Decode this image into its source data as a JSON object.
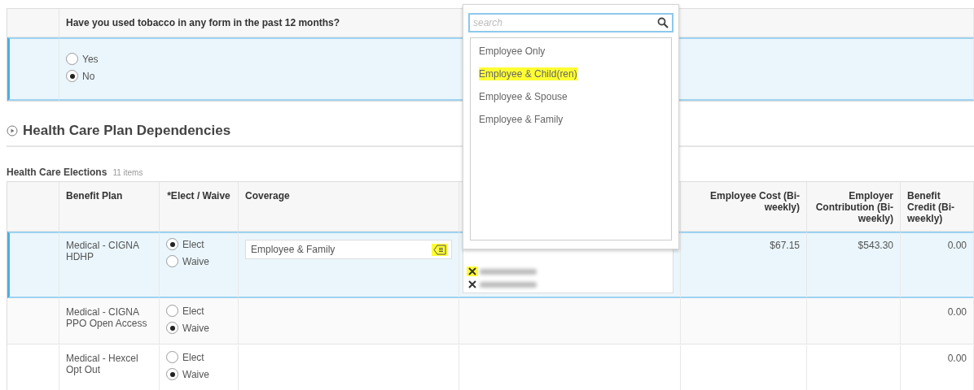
{
  "tobacco_question": {
    "question": "Have you used tobacco in any form in the past 12 months?",
    "selected": true,
    "options": [
      {
        "label": "Yes",
        "selected": false
      },
      {
        "label": "No",
        "selected": true
      }
    ]
  },
  "section": {
    "title": "Health Care Plan Dependencies"
  },
  "elections": {
    "title": "Health Care Elections",
    "count": "11 items",
    "columns": [
      "Benefit Plan",
      "*Elect / Waive",
      "Coverage",
      "Employee Cost (Bi-weekly)",
      "Employer Contribution (Bi-weekly)",
      "Benefit Credit (Bi-weekly)"
    ],
    "rows": [
      {
        "plan": "Medical - CIGNA HDHP",
        "selected": true,
        "choices": [
          {
            "label": "Elect",
            "selected": true
          },
          {
            "label": "Waive",
            "selected": false
          }
        ],
        "coverage": {
          "value": "Employee & Family",
          "icon_highlighted": true
        },
        "dependents": [
          {
            "highlighted": true
          },
          {
            "highlighted": false
          }
        ],
        "employee_cost": "$67.15",
        "employer_contribution": "$543.30",
        "benefit_credit": "0.00"
      },
      {
        "plan": "Medical - CIGNA PPO Open Access",
        "selected": false,
        "choices": [
          {
            "label": "Elect",
            "selected": false
          },
          {
            "label": "Waive",
            "selected": true
          }
        ],
        "benefit_credit": "0.00"
      },
      {
        "plan": "Medical - Hexcel Opt Out",
        "selected": false,
        "choices": [
          {
            "label": "Elect",
            "selected": false
          },
          {
            "label": "Waive",
            "selected": true
          }
        ],
        "benefit_credit": "0.00"
      }
    ]
  },
  "dropdown": {
    "search_placeholder": "search",
    "options": [
      {
        "label": "Employee Only",
        "highlighted": false
      },
      {
        "label": "Employee & Child(ren)",
        "highlighted": true
      },
      {
        "label": "Employee & Spouse",
        "highlighted": false
      },
      {
        "label": "Employee & Family",
        "highlighted": false
      }
    ]
  }
}
